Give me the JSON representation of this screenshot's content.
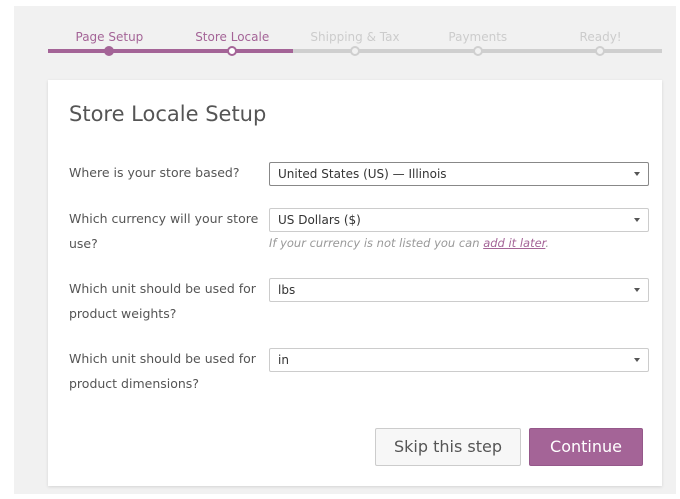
{
  "steps": [
    {
      "label": "Page Setup",
      "state": "done"
    },
    {
      "label": "Store Locale",
      "state": "active"
    },
    {
      "label": "Shipping & Tax",
      "state": "todo"
    },
    {
      "label": "Payments",
      "state": "todo"
    },
    {
      "label": "Ready!",
      "state": "todo"
    }
  ],
  "title": "Store Locale Setup",
  "fields": {
    "store_based": {
      "label": "Where is your store based?",
      "value": "United States (US) — Illinois"
    },
    "currency": {
      "label": "Which currency will your store use?",
      "value": "US Dollars ($)",
      "note_prefix": "If your currency is not listed you can ",
      "note_link": "add it later",
      "note_suffix": "."
    },
    "weight_unit": {
      "label": "Which unit should be used for product weights?",
      "value": "lbs"
    },
    "dimension_unit": {
      "label": "Which unit should be used for product dimensions?",
      "value": "in"
    }
  },
  "buttons": {
    "skip": "Skip this step",
    "continue": "Continue"
  },
  "colors": {
    "accent": "#a46497",
    "inactive": "#cfcfcf"
  }
}
